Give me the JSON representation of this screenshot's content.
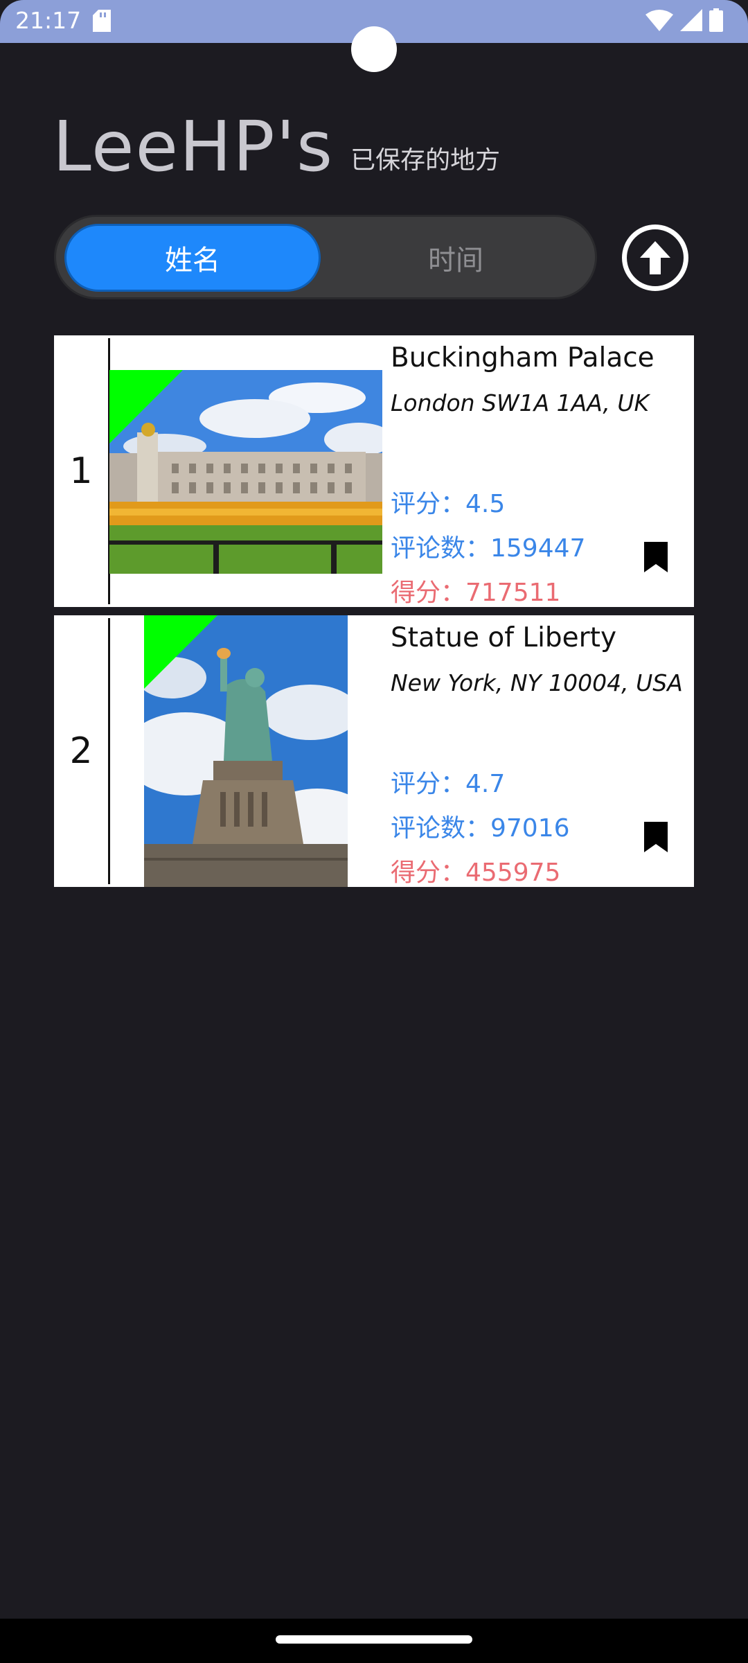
{
  "status": {
    "time": "21:17"
  },
  "header": {
    "title": "LeeHP's",
    "subtitle": "已保存的地方"
  },
  "sort_toggle": {
    "active_label": "姓名",
    "inactive_label": "时间",
    "icon": "arrow-up-circle-icon"
  },
  "places": [
    {
      "index": "1",
      "name": "Buckingham Palace",
      "address": "London SW1A 1AA, UK",
      "rating": "评分：4.5",
      "reviews": "评论数：159447",
      "score": "得分：717511"
    },
    {
      "index": "2",
      "name": "Statue of Liberty",
      "address": "New York, NY 10004, USA",
      "rating": "评分：4.7",
      "reviews": "评论数：97016",
      "score": "得分：455975"
    }
  ],
  "colors": {
    "accent": "#1e88fb",
    "stat_blue": "#3a86e8",
    "score_red": "#ea6b72",
    "ribbon": "#00ff00",
    "background": "#1c1b21"
  }
}
